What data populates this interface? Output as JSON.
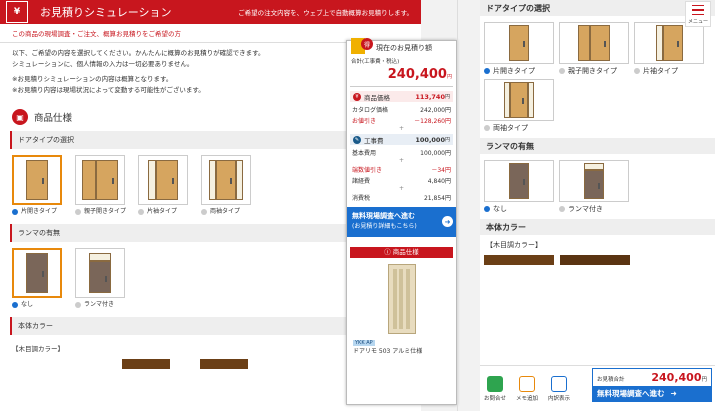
{
  "header": {
    "logo": "¥",
    "title": "お見積りシミュレーション",
    "note": "ご希望の注文内容を、ウェブ上で自動概算お見積りします。"
  },
  "notice": "この商品の現場調査・ご注文、概算お見積りをご希望の方",
  "intro": [
    "以下、ご希望の内容を選択してください。かんたんに概算のお見積りが確認できます。",
    "シミュレーションに、個人情報の入力は一切必要ありません。",
    "",
    "※お見積りシミュレーションの内容は概算となります。",
    "※お見積り内容は現場状況によって変動する可能性がございます。"
  ],
  "section_title": "商品仕様",
  "left": {
    "door_type": {
      "title": "ドアタイプの選択",
      "options": [
        {
          "label": "片開きタイプ",
          "selected": true
        },
        {
          "label": "親子開きタイプ",
          "selected": false
        },
        {
          "label": "片袖タイプ",
          "selected": false
        },
        {
          "label": "両袖タイプ",
          "selected": false
        }
      ]
    },
    "ranma": {
      "title": "ランマの有無",
      "options": [
        {
          "label": "なし",
          "selected": true
        },
        {
          "label": "ランマ付き",
          "selected": false
        }
      ]
    },
    "color": {
      "title": "本体カラー",
      "sub": "【木目調カラー】"
    }
  },
  "popup": {
    "badge": "得",
    "title": "現在のお見積り額",
    "total_label": "合計(工事費・税込)",
    "total": "240,400",
    "yen": "円",
    "product": {
      "label": "商品価格",
      "value": "113,740",
      "unit": "円",
      "rows": [
        {
          "k": "カタログ価格",
          "v": "242,000",
          "u": "円"
        },
        {
          "k": "お値引き",
          "v": "－128,260",
          "u": "円"
        }
      ]
    },
    "work": {
      "label": "工事費",
      "value": "100,000",
      "unit": "円",
      "rows": [
        {
          "k": "基本費用",
          "v": "100,000",
          "u": "円"
        }
      ]
    },
    "extra": [
      {
        "k": "端数値引き",
        "v": "－34",
        "u": "円"
      },
      {
        "k": "諸経費",
        "v": "4,840",
        "u": "円"
      }
    ],
    "tax": {
      "k": "消費税",
      "v": "21,854",
      "u": "円"
    },
    "plus": "+",
    "cta": {
      "line1": "無料現場調査へ進む",
      "line2": "(お見積り詳細もこちら)"
    },
    "spec": {
      "title": "商品仕様",
      "maker": "YKK AP",
      "name": "ドアリモ 503 アルミ仕様"
    }
  },
  "menu": {
    "label": "メニュー"
  },
  "right": {
    "door_type": {
      "title": "ドアタイプの選択",
      "options": [
        {
          "label": "片開きタイプ",
          "selected": true
        },
        {
          "label": "親子開きタイプ",
          "selected": false
        },
        {
          "label": "片袖タイプ",
          "selected": false
        },
        {
          "label": "両袖タイプ",
          "selected": false
        }
      ]
    },
    "ranma": {
      "title": "ランマの有無",
      "options": [
        {
          "label": "なし",
          "selected": true
        },
        {
          "label": "ランマ付き",
          "selected": false
        }
      ]
    },
    "color": {
      "title": "本体カラー",
      "sub": "【木目調カラー】"
    }
  },
  "bottombar": {
    "contact": "お問合せ",
    "memo": "メモ追加",
    "detail": "内訳表示",
    "est_label": "お見積合計",
    "est_value": "240,400",
    "yen": "円",
    "go": "無料現場調査へ進む"
  },
  "colors": {
    "brand": "#c8161e",
    "accent": "#1a6fcf",
    "select": "#e8890c"
  }
}
